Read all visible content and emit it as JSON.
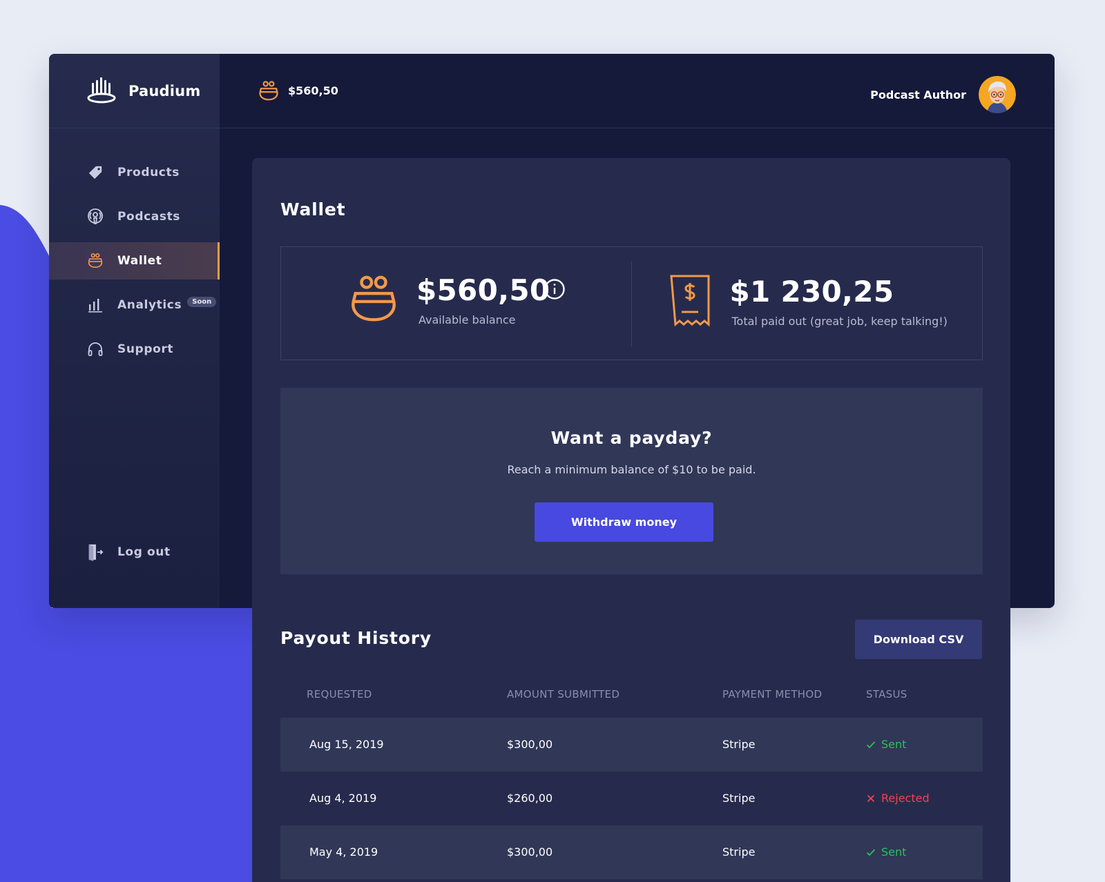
{
  "brand": {
    "name": "Paudium"
  },
  "header": {
    "balance": "$560,50",
    "user_name": "Podcast Author"
  },
  "sidebar": {
    "items": [
      {
        "label": "Products",
        "icon": "tag-icon"
      },
      {
        "label": "Podcasts",
        "icon": "podcast-icon"
      },
      {
        "label": "Wallet",
        "icon": "wallet-icon",
        "active": true
      },
      {
        "label": "Analytics",
        "icon": "bar-chart-icon",
        "badge": "Soon"
      },
      {
        "label": "Support",
        "icon": "headphones-icon"
      }
    ],
    "logout": "Log out"
  },
  "wallet": {
    "title": "Wallet",
    "available": {
      "value": "$560,50",
      "label": "Available balance"
    },
    "paid_out": {
      "value": "$1 230,25",
      "label": "Total paid out (great job, keep talking!)"
    }
  },
  "payday": {
    "title": "Want a payday?",
    "subtitle": "Reach a minimum balance of $10 to be paid.",
    "button": "Withdraw money"
  },
  "history": {
    "title": "Payout History",
    "download": "Download CSV",
    "columns": [
      "REQUESTED",
      "AMOUNT SUBMITTED",
      "PAYMENT METHOD",
      "STASUS"
    ],
    "rows": [
      {
        "date": "Aug 15, 2019",
        "amount": "$300,00",
        "method": "Stripe",
        "status": "Sent"
      },
      {
        "date": "Aug 4, 2019",
        "amount": "$260,00",
        "method": "Stripe",
        "status": "Rejected"
      },
      {
        "date": "May 4, 2019",
        "amount": "$300,00",
        "method": "Stripe",
        "status": "Sent"
      }
    ]
  },
  "colors": {
    "accent": "#f2994a",
    "primary": "#4749e0",
    "success": "#2fbf5a",
    "danger": "#f0434f"
  }
}
